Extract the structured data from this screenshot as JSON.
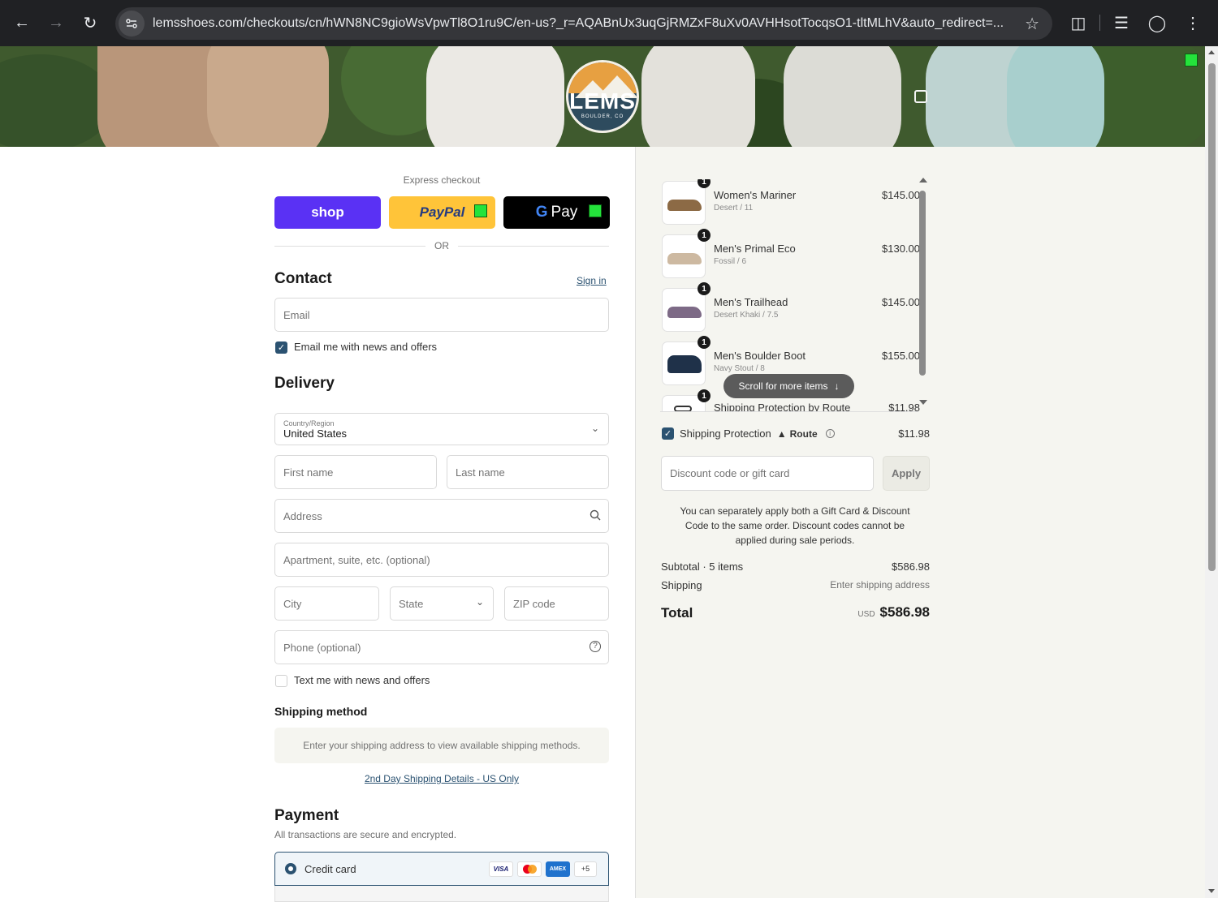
{
  "browser": {
    "url": "lemsshoes.com/checkouts/cn/hWN8NC9gioWsVpwTl8O1ru9C/en-us?_r=AQABnUx3uqGjRMZxF8uXv0AVHHsotTocqsO1-tltMLhV&auto_redirect=...",
    "icons": [
      "back-icon",
      "forward-icon",
      "reload-icon",
      "site-info-icon",
      "bookmark-star-icon",
      "extensions-icon",
      "media-controls-icon",
      "profile-icon",
      "menu-icon"
    ]
  },
  "banner": {
    "logo_text": "LEMS",
    "logo_sub": "BOULDER, CO"
  },
  "express": {
    "title": "Express checkout",
    "shop_label": "shop",
    "paypal_label": "PayPal",
    "gpay_label": "Pay",
    "or_label": "OR"
  },
  "contact": {
    "heading": "Contact",
    "sign_in": "Sign in",
    "email_placeholder": "Email",
    "newsletter_label": "Email me with news and offers",
    "newsletter_checked": true
  },
  "delivery": {
    "heading": "Delivery",
    "country_label": "Country/Region",
    "country_value": "United States",
    "first_name_placeholder": "First name",
    "last_name_placeholder": "Last name",
    "address_placeholder": "Address",
    "apartment_placeholder": "Apartment, suite, etc. (optional)",
    "city_placeholder": "City",
    "state_placeholder": "State",
    "zip_placeholder": "ZIP code",
    "phone_placeholder": "Phone (optional)",
    "sms_label": "Text me with news and offers",
    "sms_checked": false
  },
  "shipping_method": {
    "heading": "Shipping method",
    "notice": "Enter your shipping address to view available shipping methods.",
    "details_link": "2nd Day Shipping Details - US Only"
  },
  "payment": {
    "heading": "Payment",
    "subtitle": "All transactions are secure and encrypted.",
    "method_label": "Credit card",
    "card_brands": [
      "VISA",
      "mastercard",
      "AMEX"
    ],
    "more_brands": "+5"
  },
  "order": {
    "items": [
      {
        "qty": "1",
        "name": "Women's Mariner",
        "variant": "Desert / 11",
        "price": "$145.00",
        "color": "#8c6a45"
      },
      {
        "qty": "1",
        "name": "Men's Primal Eco",
        "variant": "Fossil / 6",
        "price": "$130.00",
        "color": "#cdb9a1"
      },
      {
        "qty": "1",
        "name": "Men's Trailhead",
        "variant": "Desert Khaki / 7.5",
        "price": "$145.00",
        "color": "#7d6a86"
      },
      {
        "qty": "1",
        "name": "Men's Boulder Boot",
        "variant": "Navy Stout / 8",
        "price": "$155.00",
        "color": "#1f3149"
      },
      {
        "qty": "1",
        "name": "Shipping Protection by Route",
        "variant": "",
        "price": "$11.98",
        "color": "#333333"
      }
    ],
    "scroll_hint": "Scroll for more items",
    "protection_label": "Shipping Protection",
    "protection_brand": "Route",
    "protection_price": "$11.98",
    "protection_checked": true,
    "discount_placeholder": "Discount code or gift card",
    "apply_label": "Apply",
    "discount_note": "You can separately apply both a Gift Card & Discount Code to the same order. Discount codes cannot be applied during sale periods.",
    "subtotal_label": "Subtotal · 5 items",
    "subtotal_value": "$586.98",
    "shipping_label": "Shipping",
    "shipping_value": "Enter shipping address",
    "total_label": "Total",
    "currency": "USD",
    "total_value": "$586.98"
  },
  "colors": {
    "shop": "#5a31f4",
    "paypal": "#ffc439",
    "gpay": "#000000",
    "accent": "#2b5271"
  }
}
